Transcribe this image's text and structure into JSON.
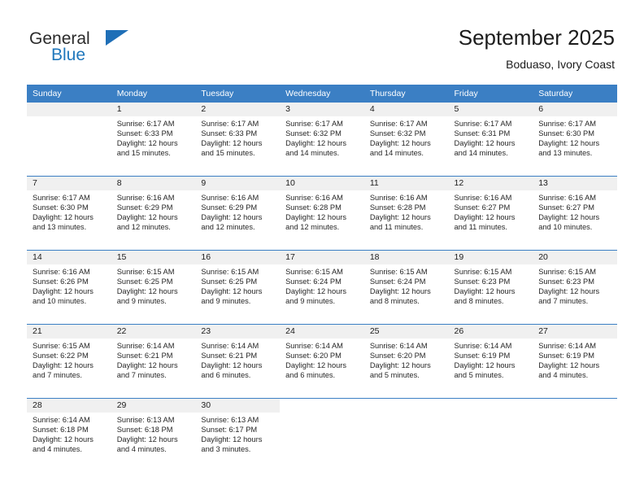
{
  "brand": {
    "name_part1": "General",
    "name_part2": "Blue",
    "flag_icon": "triangle-flag-icon",
    "accent_color": "#1f6fb7"
  },
  "header": {
    "title": "September 2025",
    "subtitle": "Boduaso, Ivory Coast"
  },
  "theme": {
    "header_row_bg": "#3b7fc4",
    "daynum_band_bg": "#f0f0f0",
    "separator_color": "#3b7fc4",
    "text_color": "#262626"
  },
  "calendar": {
    "weekday_headers": [
      "Sunday",
      "Monday",
      "Tuesday",
      "Wednesday",
      "Thursday",
      "Friday",
      "Saturday"
    ],
    "weeks": [
      [
        {
          "day": "",
          "lines": []
        },
        {
          "day": "1",
          "lines": [
            "Sunrise: 6:17 AM",
            "Sunset: 6:33 PM",
            "Daylight: 12 hours",
            "and 15 minutes."
          ]
        },
        {
          "day": "2",
          "lines": [
            "Sunrise: 6:17 AM",
            "Sunset: 6:33 PM",
            "Daylight: 12 hours",
            "and 15 minutes."
          ]
        },
        {
          "day": "3",
          "lines": [
            "Sunrise: 6:17 AM",
            "Sunset: 6:32 PM",
            "Daylight: 12 hours",
            "and 14 minutes."
          ]
        },
        {
          "day": "4",
          "lines": [
            "Sunrise: 6:17 AM",
            "Sunset: 6:32 PM",
            "Daylight: 12 hours",
            "and 14 minutes."
          ]
        },
        {
          "day": "5",
          "lines": [
            "Sunrise: 6:17 AM",
            "Sunset: 6:31 PM",
            "Daylight: 12 hours",
            "and 14 minutes."
          ]
        },
        {
          "day": "6",
          "lines": [
            "Sunrise: 6:17 AM",
            "Sunset: 6:30 PM",
            "Daylight: 12 hours",
            "and 13 minutes."
          ]
        }
      ],
      [
        {
          "day": "7",
          "lines": [
            "Sunrise: 6:17 AM",
            "Sunset: 6:30 PM",
            "Daylight: 12 hours",
            "and 13 minutes."
          ]
        },
        {
          "day": "8",
          "lines": [
            "Sunrise: 6:16 AM",
            "Sunset: 6:29 PM",
            "Daylight: 12 hours",
            "and 12 minutes."
          ]
        },
        {
          "day": "9",
          "lines": [
            "Sunrise: 6:16 AM",
            "Sunset: 6:29 PM",
            "Daylight: 12 hours",
            "and 12 minutes."
          ]
        },
        {
          "day": "10",
          "lines": [
            "Sunrise: 6:16 AM",
            "Sunset: 6:28 PM",
            "Daylight: 12 hours",
            "and 12 minutes."
          ]
        },
        {
          "day": "11",
          "lines": [
            "Sunrise: 6:16 AM",
            "Sunset: 6:28 PM",
            "Daylight: 12 hours",
            "and 11 minutes."
          ]
        },
        {
          "day": "12",
          "lines": [
            "Sunrise: 6:16 AM",
            "Sunset: 6:27 PM",
            "Daylight: 12 hours",
            "and 11 minutes."
          ]
        },
        {
          "day": "13",
          "lines": [
            "Sunrise: 6:16 AM",
            "Sunset: 6:27 PM",
            "Daylight: 12 hours",
            "and 10 minutes."
          ]
        }
      ],
      [
        {
          "day": "14",
          "lines": [
            "Sunrise: 6:16 AM",
            "Sunset: 6:26 PM",
            "Daylight: 12 hours",
            "and 10 minutes."
          ]
        },
        {
          "day": "15",
          "lines": [
            "Sunrise: 6:15 AM",
            "Sunset: 6:25 PM",
            "Daylight: 12 hours",
            "and 9 minutes."
          ]
        },
        {
          "day": "16",
          "lines": [
            "Sunrise: 6:15 AM",
            "Sunset: 6:25 PM",
            "Daylight: 12 hours",
            "and 9 minutes."
          ]
        },
        {
          "day": "17",
          "lines": [
            "Sunrise: 6:15 AM",
            "Sunset: 6:24 PM",
            "Daylight: 12 hours",
            "and 9 minutes."
          ]
        },
        {
          "day": "18",
          "lines": [
            "Sunrise: 6:15 AM",
            "Sunset: 6:24 PM",
            "Daylight: 12 hours",
            "and 8 minutes."
          ]
        },
        {
          "day": "19",
          "lines": [
            "Sunrise: 6:15 AM",
            "Sunset: 6:23 PM",
            "Daylight: 12 hours",
            "and 8 minutes."
          ]
        },
        {
          "day": "20",
          "lines": [
            "Sunrise: 6:15 AM",
            "Sunset: 6:23 PM",
            "Daylight: 12 hours",
            "and 7 minutes."
          ]
        }
      ],
      [
        {
          "day": "21",
          "lines": [
            "Sunrise: 6:15 AM",
            "Sunset: 6:22 PM",
            "Daylight: 12 hours",
            "and 7 minutes."
          ]
        },
        {
          "day": "22",
          "lines": [
            "Sunrise: 6:14 AM",
            "Sunset: 6:21 PM",
            "Daylight: 12 hours",
            "and 7 minutes."
          ]
        },
        {
          "day": "23",
          "lines": [
            "Sunrise: 6:14 AM",
            "Sunset: 6:21 PM",
            "Daylight: 12 hours",
            "and 6 minutes."
          ]
        },
        {
          "day": "24",
          "lines": [
            "Sunrise: 6:14 AM",
            "Sunset: 6:20 PM",
            "Daylight: 12 hours",
            "and 6 minutes."
          ]
        },
        {
          "day": "25",
          "lines": [
            "Sunrise: 6:14 AM",
            "Sunset: 6:20 PM",
            "Daylight: 12 hours",
            "and 5 minutes."
          ]
        },
        {
          "day": "26",
          "lines": [
            "Sunrise: 6:14 AM",
            "Sunset: 6:19 PM",
            "Daylight: 12 hours",
            "and 5 minutes."
          ]
        },
        {
          "day": "27",
          "lines": [
            "Sunrise: 6:14 AM",
            "Sunset: 6:19 PM",
            "Daylight: 12 hours",
            "and 4 minutes."
          ]
        }
      ],
      [
        {
          "day": "28",
          "lines": [
            "Sunrise: 6:14 AM",
            "Sunset: 6:18 PM",
            "Daylight: 12 hours",
            "and 4 minutes."
          ]
        },
        {
          "day": "29",
          "lines": [
            "Sunrise: 6:13 AM",
            "Sunset: 6:18 PM",
            "Daylight: 12 hours",
            "and 4 minutes."
          ]
        },
        {
          "day": "30",
          "lines": [
            "Sunrise: 6:13 AM",
            "Sunset: 6:17 PM",
            "Daylight: 12 hours",
            "and 3 minutes."
          ]
        },
        {
          "day": "",
          "lines": []
        },
        {
          "day": "",
          "lines": []
        },
        {
          "day": "",
          "lines": []
        },
        {
          "day": "",
          "lines": []
        }
      ]
    ]
  }
}
